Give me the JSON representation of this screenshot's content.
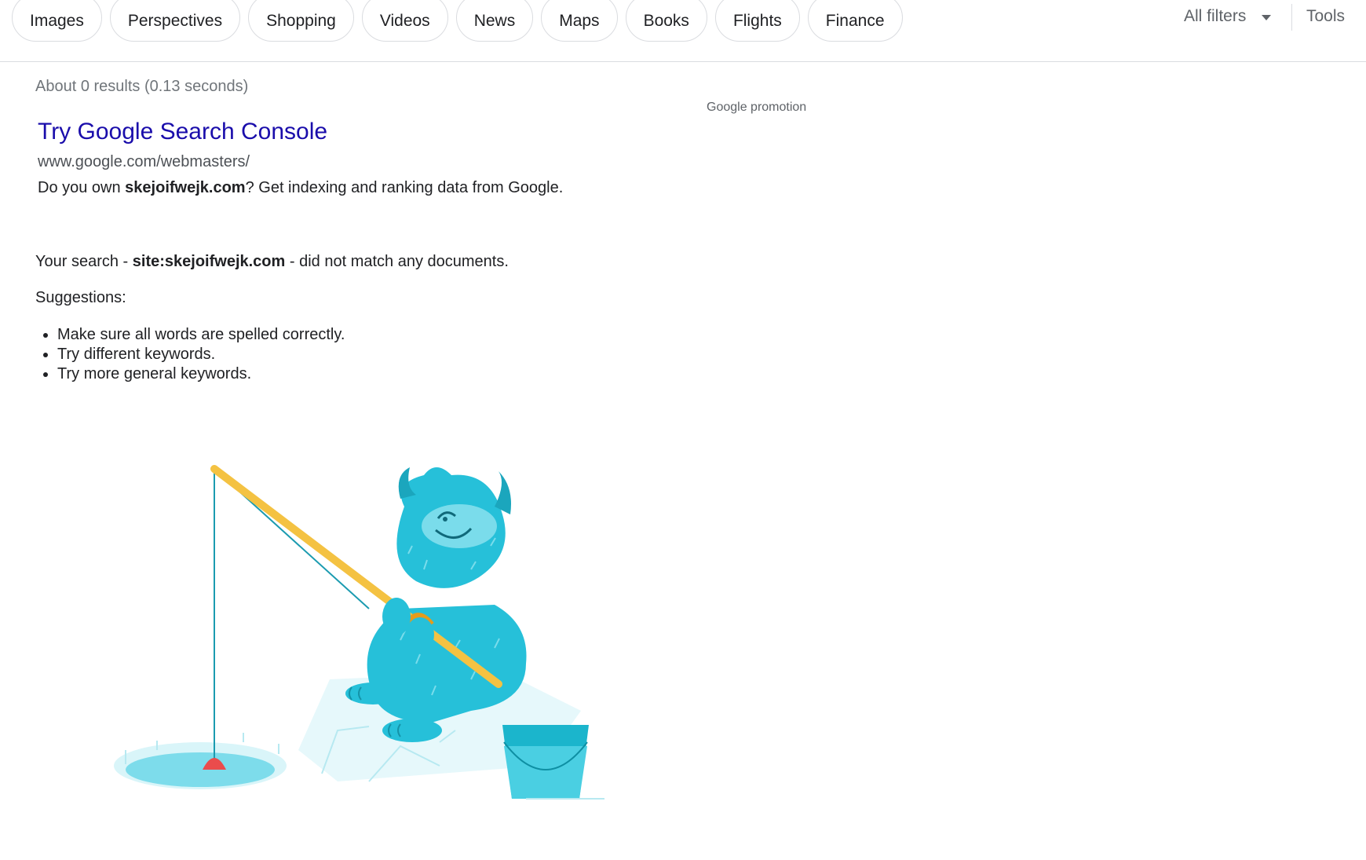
{
  "filters": {
    "chips": [
      "Images",
      "Perspectives",
      "Shopping",
      "Videos",
      "News",
      "Maps",
      "Books",
      "Flights",
      "Finance"
    ],
    "all_filters_label": "All filters",
    "tools_label": "Tools"
  },
  "results": {
    "stats": "About 0 results (0.13 seconds)",
    "promotion_label": "Google promotion",
    "ad": {
      "title": "Try Google Search Console",
      "url": "www.google.com/webmasters/",
      "desc_prefix": "Do you own ",
      "desc_bold": "skejoifwejk.com",
      "desc_suffix": "? Get indexing and ranking data from Google."
    },
    "no_match": {
      "prefix": "Your search - ",
      "query": "site:skejoifwejk.com",
      "suffix": " - did not match any documents."
    },
    "suggestions_title": "Suggestions:",
    "suggestions": [
      "Make sure all words are spelled correctly.",
      "Try different keywords.",
      "Try more general keywords."
    ]
  },
  "illustration": {
    "name": "fishing-yeti-illustration",
    "colors": {
      "body": "#26C0D9",
      "belly": "#7ADCEB",
      "rod": "#F4C242",
      "reel": "#E59B1B",
      "bobber": "#EA4C4C",
      "water": "#7DDCEB",
      "ice": "#E6F8FB",
      "bucket": "#1BB5CC"
    }
  }
}
